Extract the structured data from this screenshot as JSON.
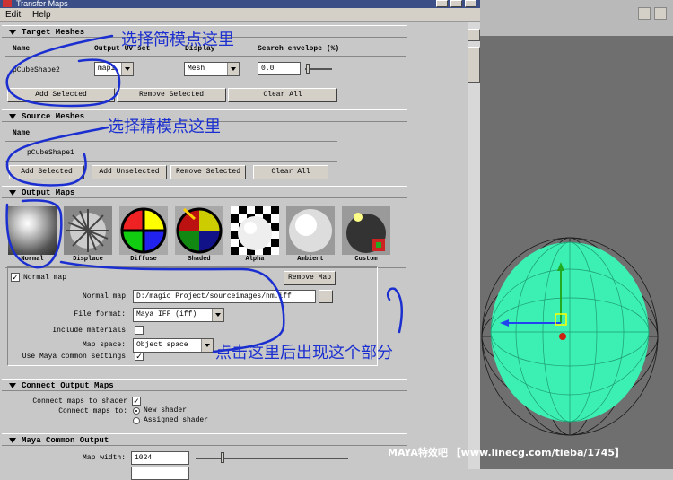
{
  "window": {
    "title": "Transfer Maps"
  },
  "menu": [
    "Edit",
    "Help"
  ],
  "target_meshes": {
    "header": "Target Meshes",
    "columns": {
      "name": "Name",
      "uv_set": "Output UV set",
      "display": "Display",
      "envelope": "Search envelope (%)"
    },
    "row": {
      "name": "pCubeShape2",
      "uv_set": "map1",
      "display": "Mesh",
      "envelope": "0.0"
    },
    "buttons": {
      "add": "Add Selected",
      "remove": "Remove Selected",
      "clear": "Clear All"
    }
  },
  "source_meshes": {
    "header": "Source Meshes",
    "column_name": "Name",
    "row_name": "pCubeShape1",
    "buttons": {
      "add": "Add Selected",
      "add_unselected": "Add Unselected",
      "remove": "Remove Selected",
      "clear": "Clear All"
    }
  },
  "output_maps": {
    "header": "Output Maps",
    "maps": [
      "Normal",
      "Displace",
      "Diffuse",
      "Shaded",
      "Alpha",
      "Ambient",
      "Custom"
    ],
    "remove_map": "Remove Map",
    "normal_map_checkbox": "Normal map",
    "normal_map_checked": true,
    "normal_map_label": "Normal map",
    "normal_map_path": "D:/magic Project/sourceimages/nm.iff",
    "file_format_label": "File format:",
    "file_format_value": "Maya IFF (iff)",
    "include_materials_label": "Include materials",
    "include_materials_checked": false,
    "map_space_label": "Map space:",
    "map_space_value": "Object space",
    "use_maya_label": "Use Maya common settings",
    "use_maya_checked": true
  },
  "connect_output_maps": {
    "header": "Connect Output Maps",
    "connect_label": "Connect maps to shader",
    "connect_checked": true,
    "connect_to_label": "Connect maps to:",
    "options": [
      "New shader",
      "Assigned shader"
    ],
    "selected": "New shader"
  },
  "maya_common_output": {
    "header": "Maya Common Output",
    "map_width_label": "Map width:",
    "map_width_value": "1024"
  },
  "annotations": {
    "low_poly": "选择简模点这里",
    "high_poly": "选择精模点这里",
    "appears": "点击这里后出现这个部分"
  },
  "watermark": "MAYA特效吧 【www.linecg.com/tieba/1745】",
  "colors": {
    "annotation": "#1b2fd0",
    "mesh_wire": "#3cf0b4",
    "title_bar": "#3b4f86"
  }
}
